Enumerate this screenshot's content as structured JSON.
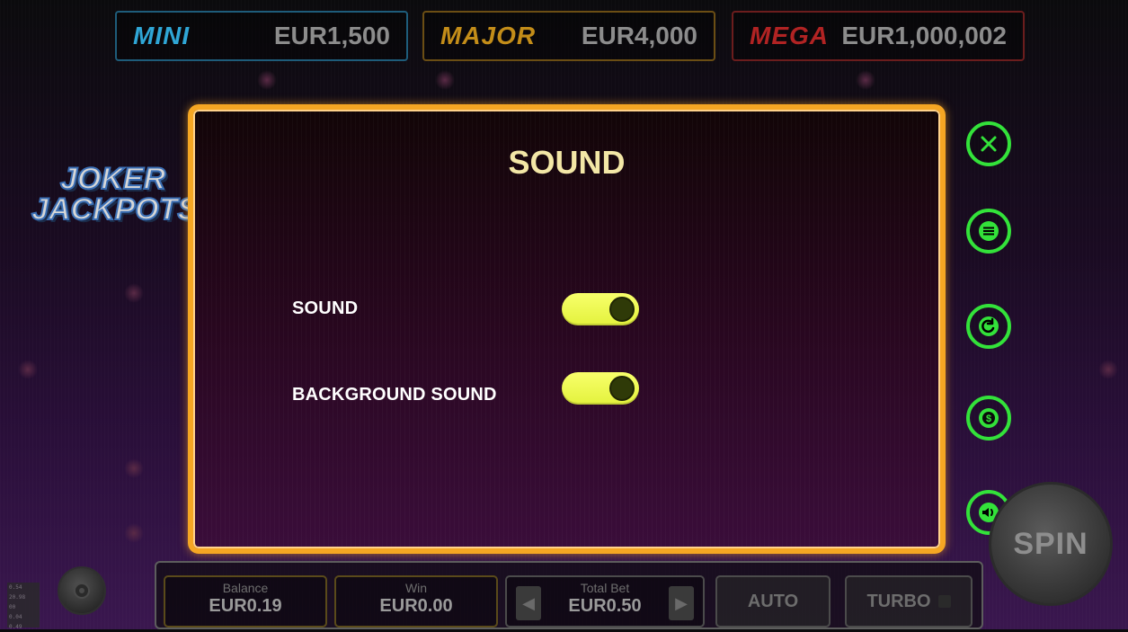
{
  "jackpots": [
    {
      "name": "MINI",
      "amount": "EUR1,500",
      "color": "#2fa6d6"
    },
    {
      "name": "MAJOR",
      "amount": "EUR4,000",
      "color": "#c38d19"
    },
    {
      "name": "MEGA",
      "amount": "EUR1,000,002",
      "color": "#b12323"
    }
  ],
  "logo": {
    "line1": "JOKER",
    "line2": "JACKPOTS"
  },
  "modal": {
    "title": "SOUND",
    "settings": [
      {
        "label": "SOUND",
        "enabled": true
      },
      {
        "label": "BACKGROUND SOUND",
        "enabled": true
      }
    ]
  },
  "side_buttons": [
    {
      "name": "close",
      "icon": "close-icon"
    },
    {
      "name": "menu",
      "icon": "menu-icon"
    },
    {
      "name": "history",
      "icon": "history-icon"
    },
    {
      "name": "bet",
      "icon": "coin-icon"
    },
    {
      "name": "sound",
      "icon": "speaker-icon"
    }
  ],
  "spin": {
    "label": "SPIN"
  },
  "bottom_bar": {
    "balance": {
      "label": "Balance",
      "value": "EUR0.19"
    },
    "win": {
      "label": "Win",
      "value": "EUR0.00"
    },
    "total_bet": {
      "label": "Total Bet",
      "value": "EUR0.50"
    },
    "auto_label": "AUTO",
    "turbo_label": "TURBO"
  },
  "left_info": [
    "0.54",
    "20.98",
    "00",
    "0.04",
    "0.49"
  ],
  "colors": {
    "accent_green": "#33e23a",
    "modal_border": "#f5a623",
    "toggle_on": "#f8ff6b"
  }
}
